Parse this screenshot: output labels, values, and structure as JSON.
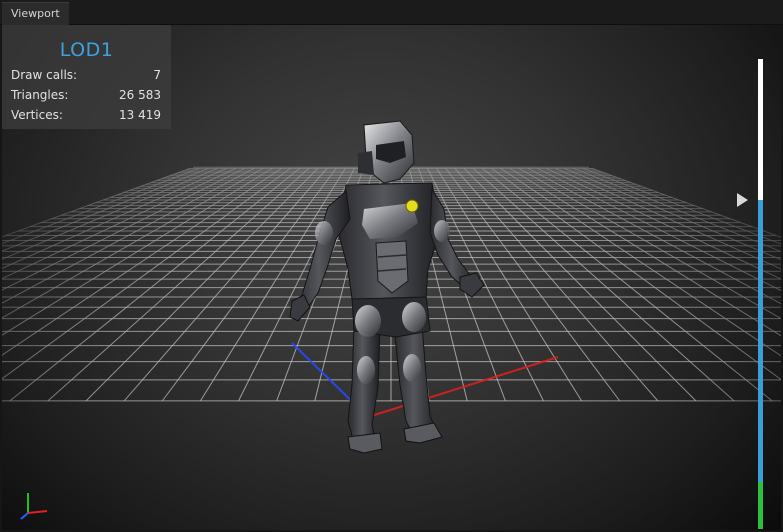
{
  "tabs": [
    {
      "label": "Viewport",
      "active": true
    }
  ],
  "stats": {
    "lod_label": "LOD1",
    "rows": [
      {
        "label": "Draw calls:",
        "value": "7"
      },
      {
        "label": "Triangles:",
        "value": "26 583"
      },
      {
        "label": "Vertices:",
        "value": "13 419"
      }
    ]
  },
  "lod_bar": {
    "marker_level": 0.3,
    "segments": [
      {
        "name": "lod0",
        "fraction": 0.3,
        "color": "#ffffff"
      },
      {
        "name": "lod1",
        "fraction": 0.6,
        "color": "#3a9fd8"
      },
      {
        "name": "lod2",
        "fraction": 0.1,
        "color": "#2fbf3a"
      }
    ]
  },
  "axis_gizmo": {
    "x_color": "#e02020",
    "y_color": "#20c020",
    "z_color": "#2060ff"
  },
  "icons": [
    "lod-marker-arrow-icon",
    "axis-gizmo-icon"
  ],
  "colors": {
    "accent": "#3aa3df",
    "grid": "#d0d0d0",
    "axis_x": "#e02020",
    "axis_z": "#2040ff"
  }
}
